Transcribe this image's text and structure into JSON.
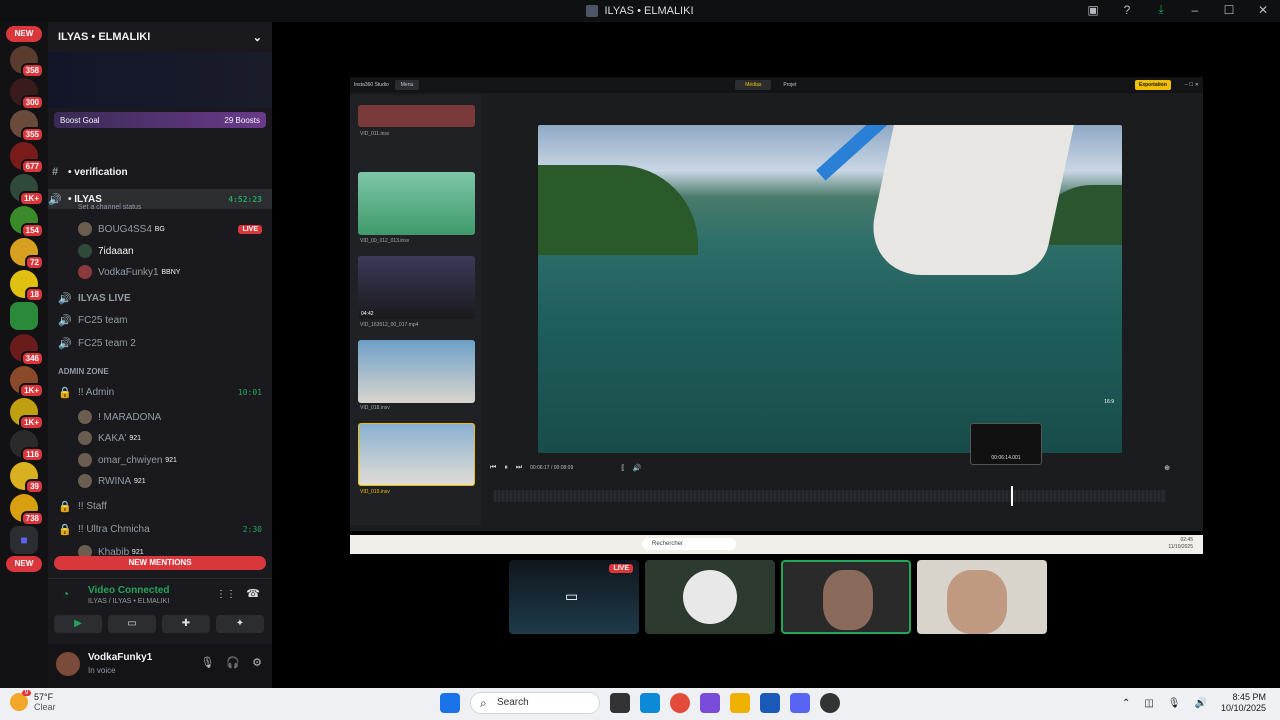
{
  "window": {
    "title": "ILYAS • ELMALIKI"
  },
  "server_list": {
    "new_top": "NEW",
    "new_bottom": "NEW",
    "badges": [
      "358",
      "300",
      "355",
      "677",
      "1K+",
      "154",
      "72",
      "18",
      "346",
      "1K+",
      "1K+",
      "116",
      "39",
      "738"
    ]
  },
  "server": {
    "name": "ILYAS • ELMALIKI",
    "boost_goal": "Boost Goal",
    "boosts": "29 Boosts"
  },
  "channels": {
    "verification": "• verification",
    "ilyas": "• ILYAS",
    "ilyas_time": "4:52:23",
    "channel_status": "Set a channel status",
    "member1": "BOUG4SS4",
    "member1_tag": "BG",
    "member1_live": "LIVE",
    "member2": "7idaaan",
    "member3": "VodkaFunky1",
    "member3_tag": "BBNY",
    "ilyas_live": "ILYAS LIVE",
    "fc25": "FC25 team",
    "fc25_2": "FC25 team 2",
    "admin_zone": "ADMIN ZONE",
    "admin": "!! Admin",
    "admin_time": "10:01",
    "maradona": "! MARADONA",
    "kaka": "KAKA'",
    "kaka_tag": "921",
    "omar": "omar_chwiyen",
    "omar_tag": "921",
    "rwina": "RWINA",
    "rwina_tag": "921",
    "staff": "!! Staff",
    "ultra": "!! Ultra Chmicha",
    "ultra_time": "2:30",
    "khabib": "Khabib",
    "khabib_tag": "921",
    "new_mentions": "NEW MENTIONS"
  },
  "voice": {
    "title": "Video Connected",
    "subtitle": "ILYAS / ILYAS • ELMALIKI"
  },
  "user": {
    "name": "VodkaFunky1",
    "status": "In voice"
  },
  "insta360": {
    "app": "Insta360 Studio",
    "menu": "Menu",
    "tab_media": "Médias",
    "tab_project": "Projet",
    "export": "Exportation",
    "files": [
      "VID_011.insv",
      "VID_00_012_013.insv",
      "VID_163512_00_017.mp4",
      "VID_018.insv",
      "VID_019.insv"
    ],
    "thumb_time": "04:42",
    "timecode": "00:06:17 / 00:08:09",
    "hover_time": "00:06:14.001",
    "ratio": "16:9",
    "playhead_fraction": 0.77
  },
  "inner_taskbar": {
    "search": "Rechercher",
    "time": "02:45",
    "date": "11/10/2025"
  },
  "stream_tiles": {
    "live": "LIVE"
  },
  "taskbar": {
    "temp": "57°F",
    "weather": "Clear",
    "notif": "9",
    "search": "Search",
    "time": "8:45 PM",
    "date": "10/10/2025"
  }
}
